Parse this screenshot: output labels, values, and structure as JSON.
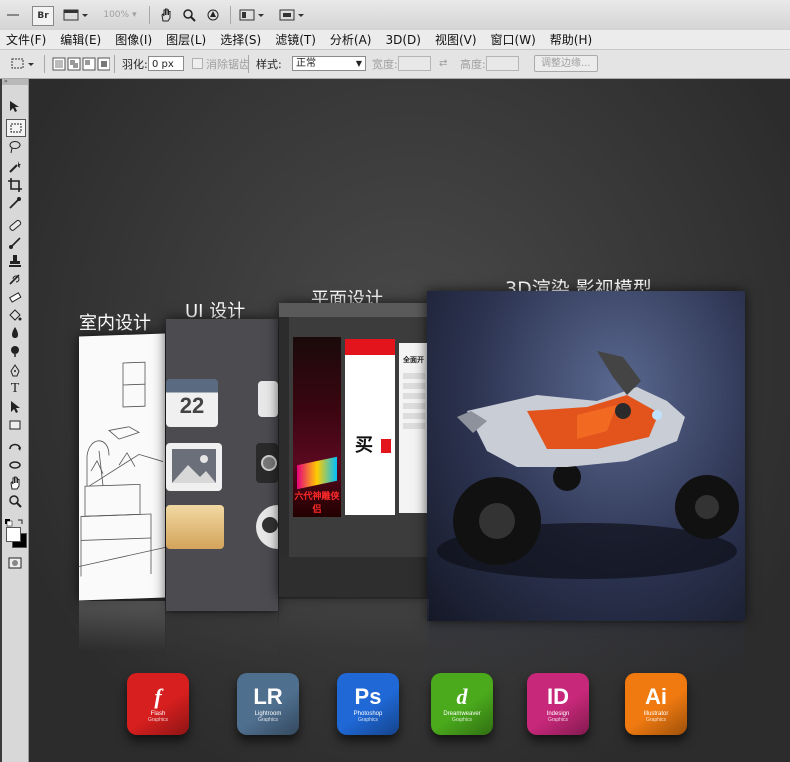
{
  "toolbar": {
    "br_label": "Br",
    "zoom_value": "100%"
  },
  "menu": {
    "items": [
      "文件(F)",
      "编辑(E)",
      "图像(I)",
      "图层(L)",
      "选择(S)",
      "滤镜(T)",
      "分析(A)",
      "3D(D)",
      "视图(V)",
      "窗口(W)",
      "帮助(H)"
    ]
  },
  "options": {
    "feather_label": "羽化:",
    "feather_value": "0 px",
    "antialias_label": "消除锯齿",
    "style_label": "样式:",
    "style_value": "正常",
    "width_label": "宽度:",
    "height_label": "高度:",
    "refine_edge_label": "调整边缘..."
  },
  "canvas": {
    "headings": {
      "interior": "室内设计",
      "ui": "UI 设计",
      "graphic": "平面设计",
      "render3d": "3D渲染 影视模型"
    },
    "ui_panel": {
      "calendar_day": "22"
    },
    "graphic_panel": {
      "red_banner_text": "六代神雕侠侣",
      "buy_text": "买",
      "store_text": "全面开"
    },
    "apps": [
      {
        "abbr": "f",
        "name": "Flash",
        "sub": "Graphics",
        "color": "#d81f1f"
      },
      {
        "abbr": "LR",
        "name": "Lightroom",
        "sub": "Graphics",
        "color": "#4f6f8f"
      },
      {
        "abbr": "Ps",
        "name": "Photoshop",
        "sub": "Graphics",
        "color": "#1f68d6"
      },
      {
        "abbr": "d",
        "name": "Dreamweaver",
        "sub": "Graphics",
        "color": "#4aaa1c"
      },
      {
        "abbr": "ID",
        "name": "Indesign",
        "sub": "Graphics",
        "color": "#c8287a"
      },
      {
        "abbr": "Ai",
        "name": "Illustrator",
        "sub": "Graphics",
        "color": "#f07a10"
      }
    ]
  },
  "colors": {
    "accent_red": "#e3141c",
    "canvas_bg": "#3a3a3a"
  }
}
